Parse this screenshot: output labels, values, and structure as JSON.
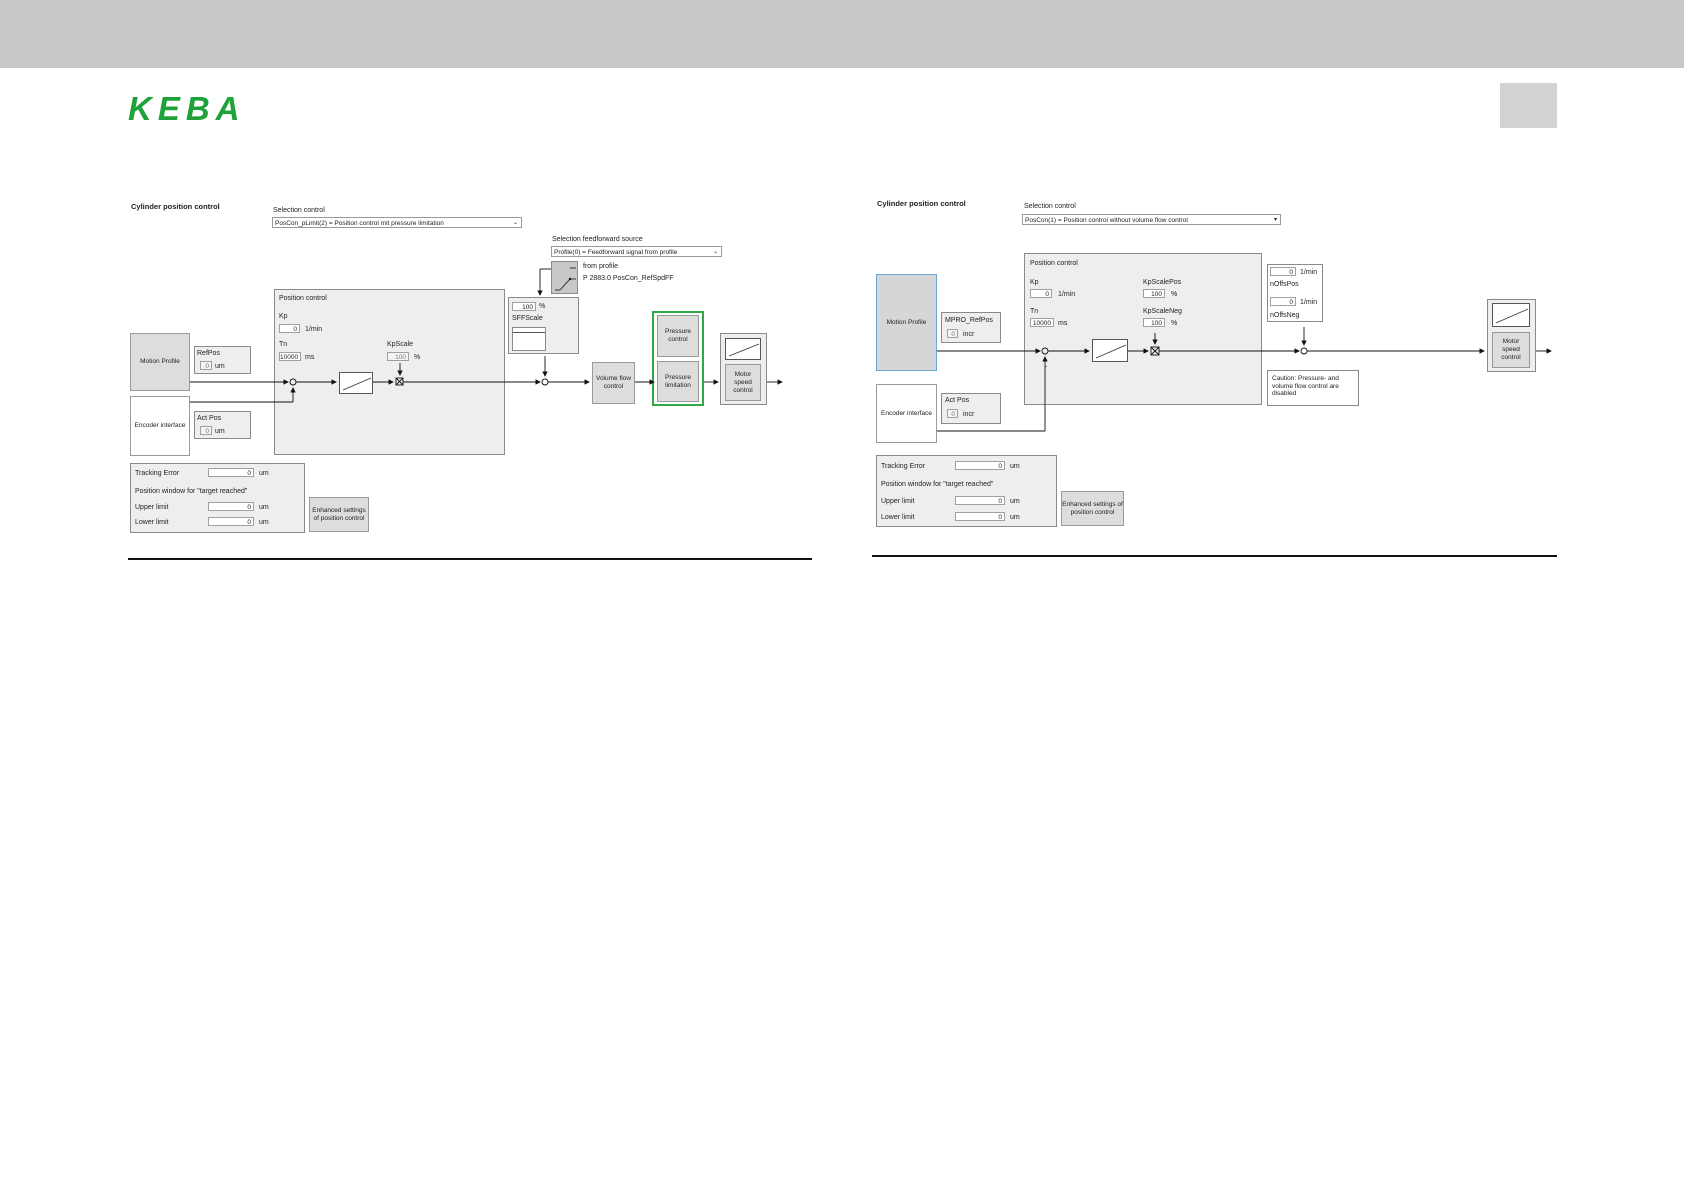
{
  "brand": {
    "logo_text": "KEBA",
    "color": "#1fa23a"
  },
  "left": {
    "title": "Cylinder position control",
    "selection_control_label": "Selection control",
    "selection_control_value": "PosCon_pLimit(2) = Position control mit pressure limitation",
    "ff_source_label": "Selection feedforward source",
    "ff_source_value": "Profile(0) = Feedforward signal from profile",
    "ff_from_profile": "from profile",
    "ff_param": "P 2883.0 PosCon_RefSpdFF",
    "sff_value": "100",
    "sff_unit": "%",
    "sff_label": "SFFScale",
    "motion_profile": "Motion Profile",
    "encoder_interface": "Encoder interface",
    "refpos_label": "RefPos",
    "refpos_value": "0",
    "refpos_unit": "um",
    "actpos_label": "Act Pos",
    "actpos_value": "0",
    "actpos_unit": "um",
    "pos_control_label": "Position control",
    "kp_label": "Kp",
    "kp_value": "0",
    "kp_unit": "1/min",
    "tn_label": "Tn",
    "tn_value": "10000",
    "tn_unit": "ms",
    "kpscale_label": "KpScale",
    "kpscale_value": "100",
    "kpscale_unit": "%",
    "volume_flow": "Volume flow control",
    "pressure_control": "Pressure control",
    "pressure_limitation": "Pressure limitation",
    "motor_speed": "Motor speed control",
    "tracking_error_label": "Tracking Error",
    "tracking_error_value": "0",
    "tracking_error_unit": "um",
    "pos_window_label": "Position window for \"target reached\"",
    "upper_label": "Upper limit",
    "upper_value": "0",
    "upper_unit": "um",
    "lower_label": "Lower limit",
    "lower_value": "0",
    "lower_unit": "um",
    "enhanced": "Enhanced settings of position control"
  },
  "right": {
    "title": "Cylinder position control",
    "selection_control_label": "Selection control",
    "selection_control_value": "PosCon(1) = Position control without volume flow control",
    "motion_profile": "Motion Profile",
    "encoder_interface": "Encoder interface",
    "mpro_label": "MPRO_RefPos",
    "mpro_value": "0",
    "mpro_unit": "incr",
    "actpos_label": "Act Pos",
    "actpos_value": "0",
    "actpos_unit": "incr",
    "pos_control_label": "Position control",
    "kp_label": "Kp",
    "kp_value": "0",
    "kp_unit": "1/min",
    "tn_label": "Tn",
    "tn_value": "10000",
    "tn_unit": "ms",
    "kpscalepos_label": "KpScalePos",
    "kpscalepos_value": "100",
    "kpscalepos_unit": "%",
    "kpscaleneg_label": "KpScaleNeg",
    "kpscaleneg_value": "100",
    "kpscaleneg_unit": "%",
    "noffspos_value": "0",
    "noffspos_unit": "1/min",
    "noffspos_label": "nOffsPos",
    "noffsneg_value": "0",
    "noffsneg_unit": "1/min",
    "noffsneg_label": "nOffsNeg",
    "caution": "Caution: Pressure- and volume flow control are disabled",
    "motor_speed": "Motor speed control",
    "minus_sign": "-",
    "tracking_error_label": "Tracking Error",
    "tracking_error_value": "0",
    "tracking_error_unit": "um",
    "pos_window_label": "Position window for \"target reached\"",
    "upper_label": "Upper limit",
    "upper_value": "0",
    "upper_unit": "um",
    "lower_label": "Lower limit",
    "lower_value": "0",
    "lower_unit": "um",
    "enhanced": "Enhanced settings of position control"
  }
}
